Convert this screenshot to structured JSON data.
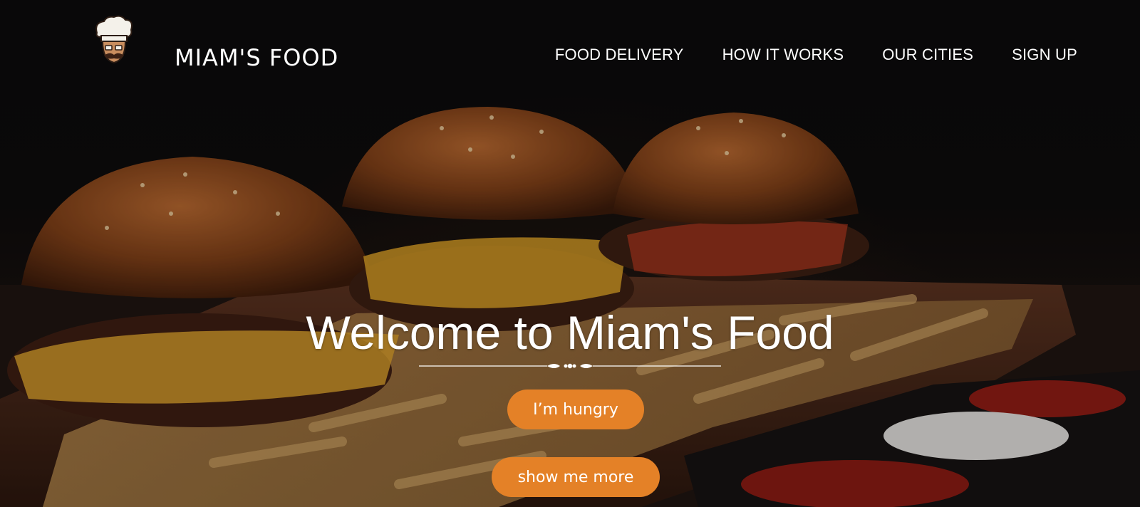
{
  "brand": {
    "name": "MIAM'S FOOD",
    "logo_icon": "chef-mascot-icon"
  },
  "nav": {
    "items": [
      {
        "label": "FOOD DELIVERY"
      },
      {
        "label": "HOW IT WORKS"
      },
      {
        "label": "OUR CITIES"
      },
      {
        "label": "SIGN UP"
      }
    ]
  },
  "hero": {
    "background_image": "burgers-and-fries-photo",
    "title": "Welcome to Miam's Food",
    "divider_icon": "ornamental-divider-icon",
    "primary_button": "I’m hungry",
    "secondary_button": "show me more"
  },
  "colors": {
    "accent": "#e48127",
    "text": "#ffffff",
    "background": "#0b0a0b"
  }
}
